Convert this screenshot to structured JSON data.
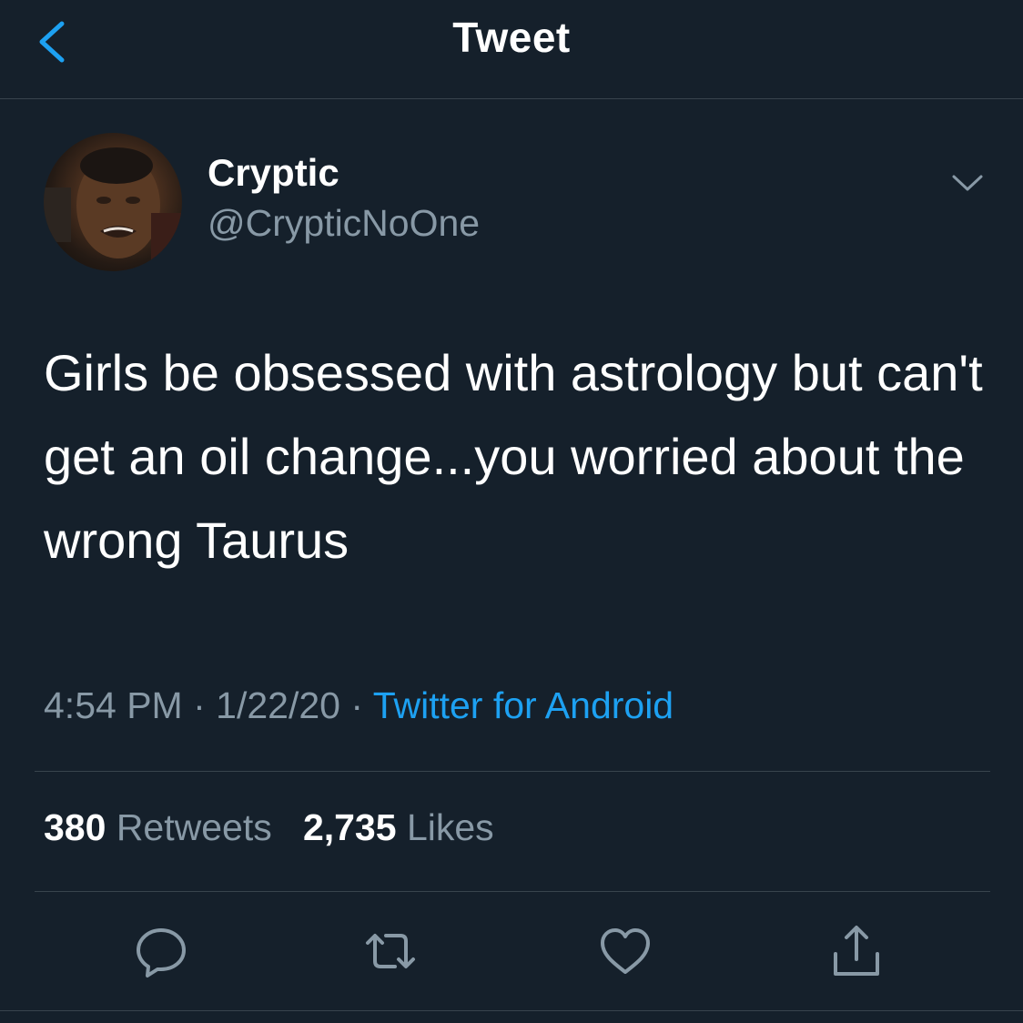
{
  "header": {
    "title": "Tweet",
    "back_icon": "chevron-left-icon"
  },
  "tweet": {
    "author": {
      "name": "Cryptic",
      "handle": "@CrypticNoOne",
      "avatar": "profile photo"
    },
    "text": "Girls be obsessed with astrology but can't get an oil change...you worried about the wrong Taurus",
    "time": "4:54 PM",
    "separator": "·",
    "date": "1/22/20",
    "source": "Twitter for Android"
  },
  "stats": {
    "retweets_count": "380",
    "retweets_label": "Retweets",
    "likes_count": "2,735",
    "likes_label": "Likes"
  },
  "actions": [
    "reply-icon",
    "retweet-icon",
    "like-icon",
    "share-icon"
  ],
  "colors": {
    "background": "#15202b",
    "accent": "#1da1f2",
    "secondary_text": "#8899a6",
    "divider": "#38444d"
  }
}
